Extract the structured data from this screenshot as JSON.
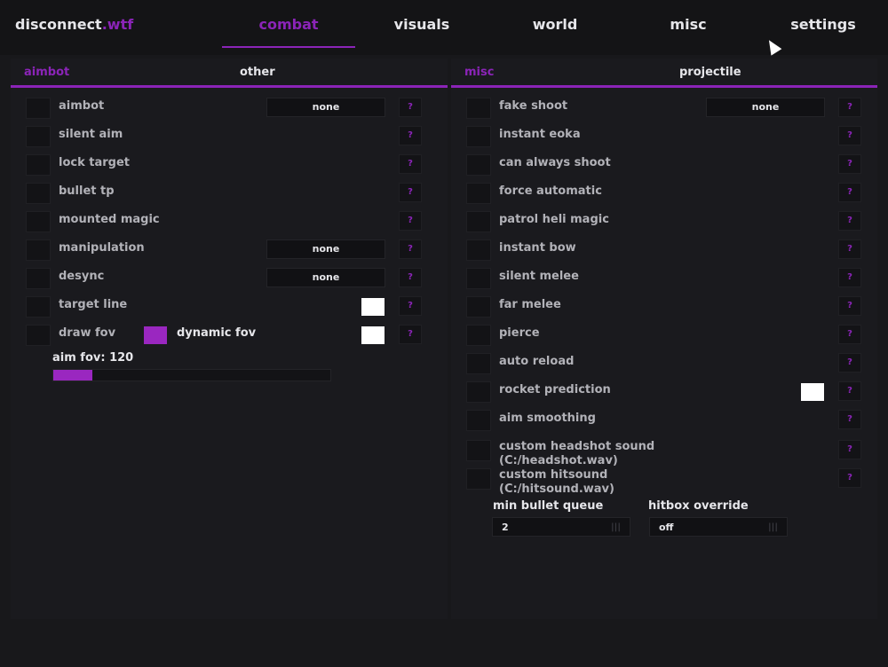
{
  "brand": {
    "name": "disconnect",
    "suffix": ".wtf"
  },
  "nav": {
    "tabs": [
      "combat",
      "visuals",
      "world",
      "misc",
      "settings"
    ],
    "active": "combat"
  },
  "left_panel": {
    "subtabs": [
      "aimbot",
      "other"
    ],
    "rows": [
      {
        "label": "aimbot",
        "dropdown": "none",
        "help": "?"
      },
      {
        "label": "silent aim",
        "help": "?"
      },
      {
        "label": "lock target",
        "help": "?"
      },
      {
        "label": "bullet tp",
        "help": "?"
      },
      {
        "label": "mounted magic",
        "help": "?"
      },
      {
        "label": "manipulation",
        "dropdown": "none",
        "help": "?"
      },
      {
        "label": "desync",
        "dropdown": "none",
        "help": "?"
      },
      {
        "label": "target line",
        "help": "?"
      },
      {
        "label": "draw fov",
        "help": "?"
      }
    ],
    "dynamic_fov_label": "dynamic fov",
    "aim_fov_label": "aim fov: 120",
    "aim_fov_fraction": 0.14
  },
  "right_panel": {
    "subtabs": [
      "misc",
      "projectile"
    ],
    "rows": [
      {
        "label": "fake shoot",
        "dropdown": "none",
        "help": "?"
      },
      {
        "label": "instant eoka",
        "help": "?"
      },
      {
        "label": "can always shoot",
        "help": "?"
      },
      {
        "label": "force automatic",
        "help": "?"
      },
      {
        "label": "patrol heli magic",
        "help": "?"
      },
      {
        "label": "instant bow",
        "help": "?"
      },
      {
        "label": "silent melee",
        "help": "?"
      },
      {
        "label": "far melee",
        "help": "?"
      },
      {
        "label": "pierce",
        "help": "?"
      },
      {
        "label": "auto reload",
        "help": "?"
      },
      {
        "label": "rocket prediction",
        "help": "?"
      },
      {
        "label": "aim smoothing",
        "help": "?"
      },
      {
        "label": "custom headshot sound",
        "label2": "(C:/headshot.wav)",
        "help": "?"
      },
      {
        "label": "custom hitsound",
        "label2": "(C:/hitsound.wav)",
        "help": "?"
      }
    ],
    "min_bullet_queue": {
      "label": "min bullet queue",
      "value": "2"
    },
    "hitbox_override": {
      "label": "hitbox override",
      "value": "off"
    }
  },
  "colors": {
    "accent": "#8b24b8",
    "background": "#18181b",
    "swatch_white": "#ffffff"
  }
}
